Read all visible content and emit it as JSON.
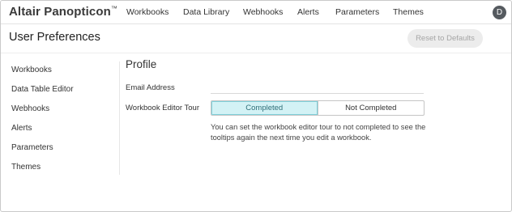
{
  "app": {
    "brand": "Altair Panopticon",
    "brand_mark": "™"
  },
  "nav": {
    "items": [
      {
        "label": "Workbooks"
      },
      {
        "label": "Data Library"
      },
      {
        "label": "Webhooks"
      },
      {
        "label": "Alerts"
      },
      {
        "label": "Parameters"
      },
      {
        "label": "Themes"
      }
    ],
    "avatar_initial": "D"
  },
  "header": {
    "title": "User Preferences",
    "reset_label": "Reset to Defaults"
  },
  "sidebar": {
    "items": [
      {
        "label": "Workbooks"
      },
      {
        "label": "Data Table Editor"
      },
      {
        "label": "Webhooks"
      },
      {
        "label": "Alerts"
      },
      {
        "label": "Parameters"
      },
      {
        "label": "Themes"
      }
    ]
  },
  "profile": {
    "title": "Profile",
    "email_label": "Email Address",
    "email_value": "",
    "tour_label": "Workbook Editor Tour",
    "tour_options": [
      {
        "label": "Completed",
        "selected": true
      },
      {
        "label": "Not Completed",
        "selected": false
      }
    ],
    "tour_help": "You can set the workbook editor tour to not completed to see the tooltips again the next time you edit a workbook."
  },
  "colors": {
    "selected_bg": "#d3f2f5",
    "selected_border": "#7fd0da",
    "avatar_bg": "#555a5f",
    "disabled_button_bg": "#ececec"
  }
}
